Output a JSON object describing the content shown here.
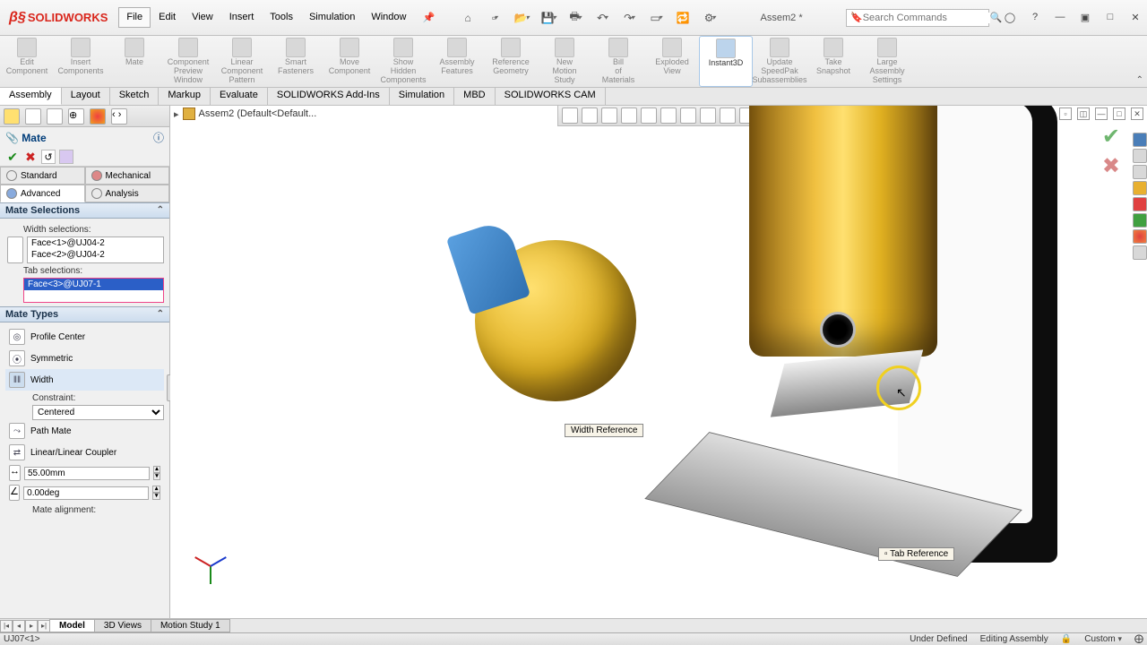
{
  "app": {
    "brand": "SOLIDWORKS",
    "doc_title": "Assem2 *"
  },
  "menu": [
    "File",
    "Edit",
    "View",
    "Insert",
    "Tools",
    "Simulation",
    "Window"
  ],
  "search_placeholder": "Search Commands",
  "ribbon": [
    {
      "label": "Edit Component"
    },
    {
      "label": "Insert Components"
    },
    {
      "label": "Mate"
    },
    {
      "label": "Component Preview Window"
    },
    {
      "label": "Linear Component Pattern"
    },
    {
      "label": "Smart Fasteners"
    },
    {
      "label": "Move Component"
    },
    {
      "label": "Show Hidden Components"
    },
    {
      "label": "Assembly Features"
    },
    {
      "label": "Reference Geometry"
    },
    {
      "label": "New Motion Study"
    },
    {
      "label": "Bill of Materials"
    },
    {
      "label": "Exploded View"
    },
    {
      "label": "Instant3D",
      "active": true
    },
    {
      "label": "Update SpeedPak Subassemblies"
    },
    {
      "label": "Take Snapshot"
    },
    {
      "label": "Large Assembly Settings"
    }
  ],
  "cmdtabs": [
    "Assembly",
    "Layout",
    "Sketch",
    "Markup",
    "Evaluate",
    "SOLIDWORKS Add-Ins",
    "Simulation",
    "MBD",
    "SOLIDWORKS CAM"
  ],
  "cmdtab_active": 0,
  "breadcrumb": "Assem2  (Default<Default...",
  "panel": {
    "title": "Mate",
    "tabs": {
      "standard": "Standard",
      "mechanical": "Mechanical",
      "advanced": "Advanced",
      "analysis": "Analysis"
    },
    "sec_selections": "Mate Selections",
    "width_label": "Width selections:",
    "width_items": [
      "Face<1>@UJ04-2",
      "Face<2>@UJ04-2"
    ],
    "tab_label": "Tab selections:",
    "tab_items": [
      "Face<3>@UJ07-1"
    ],
    "sec_types": "Mate Types",
    "types": {
      "profile": "Profile Center",
      "symmetric": "Symmetric",
      "width": "Width",
      "constraint_lbl": "Constraint:",
      "constraint_val": "Centered",
      "path": "Path Mate",
      "coupler": "Linear/Linear Coupler",
      "dist": "55.00mm",
      "ang": "0.00deg",
      "align": "Mate alignment:"
    }
  },
  "callouts": {
    "width": "Width Reference",
    "tab": "Tab Reference"
  },
  "bottom_tabs": [
    "Model",
    "3D Views",
    "Motion Study 1"
  ],
  "status": {
    "left": "UJ07<1>",
    "under": "Under Defined",
    "mode": "Editing Assembly",
    "units": "Custom"
  }
}
